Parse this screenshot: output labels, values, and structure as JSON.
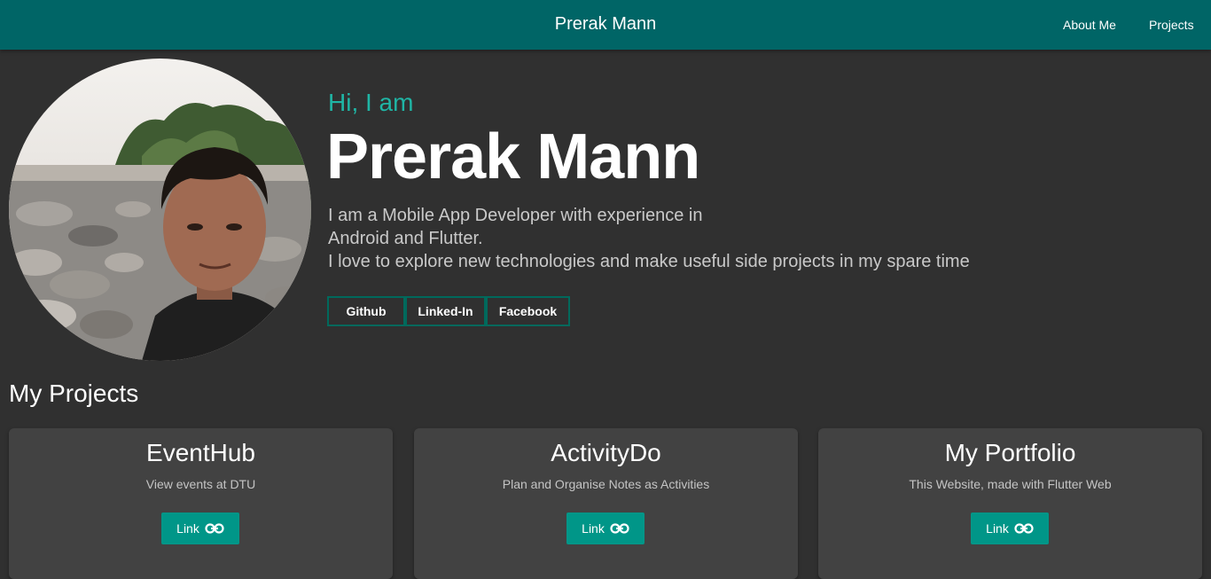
{
  "appbar": {
    "title": "Prerak Mann",
    "nav": [
      "About Me",
      "Projects"
    ]
  },
  "hero": {
    "greeting": "Hi, I am",
    "name": "Prerak Mann",
    "bio": [
      "I am a Mobile App Developer with experience in",
      "Android and Flutter.",
      "I love to explore new technologies and make useful side projects in my spare time"
    ],
    "social": [
      "Github",
      "Linked-In",
      "Facebook"
    ]
  },
  "projects": {
    "title": "My Projects",
    "items": [
      {
        "name": "EventHub",
        "description": "View events at DTU",
        "link_label": "Link"
      },
      {
        "name": "ActivityDo",
        "description": "Plan and Organise Notes as Activities",
        "link_label": "Link"
      },
      {
        "name": "My Portfolio",
        "description": "This Website, made with Flutter Web",
        "link_label": "Link"
      }
    ]
  },
  "colors": {
    "appbar": "#006566",
    "accent": "#1fb5a5",
    "button": "#009688",
    "background": "#303030",
    "card": "#424242"
  },
  "icons": [
    "link-icon"
  ]
}
